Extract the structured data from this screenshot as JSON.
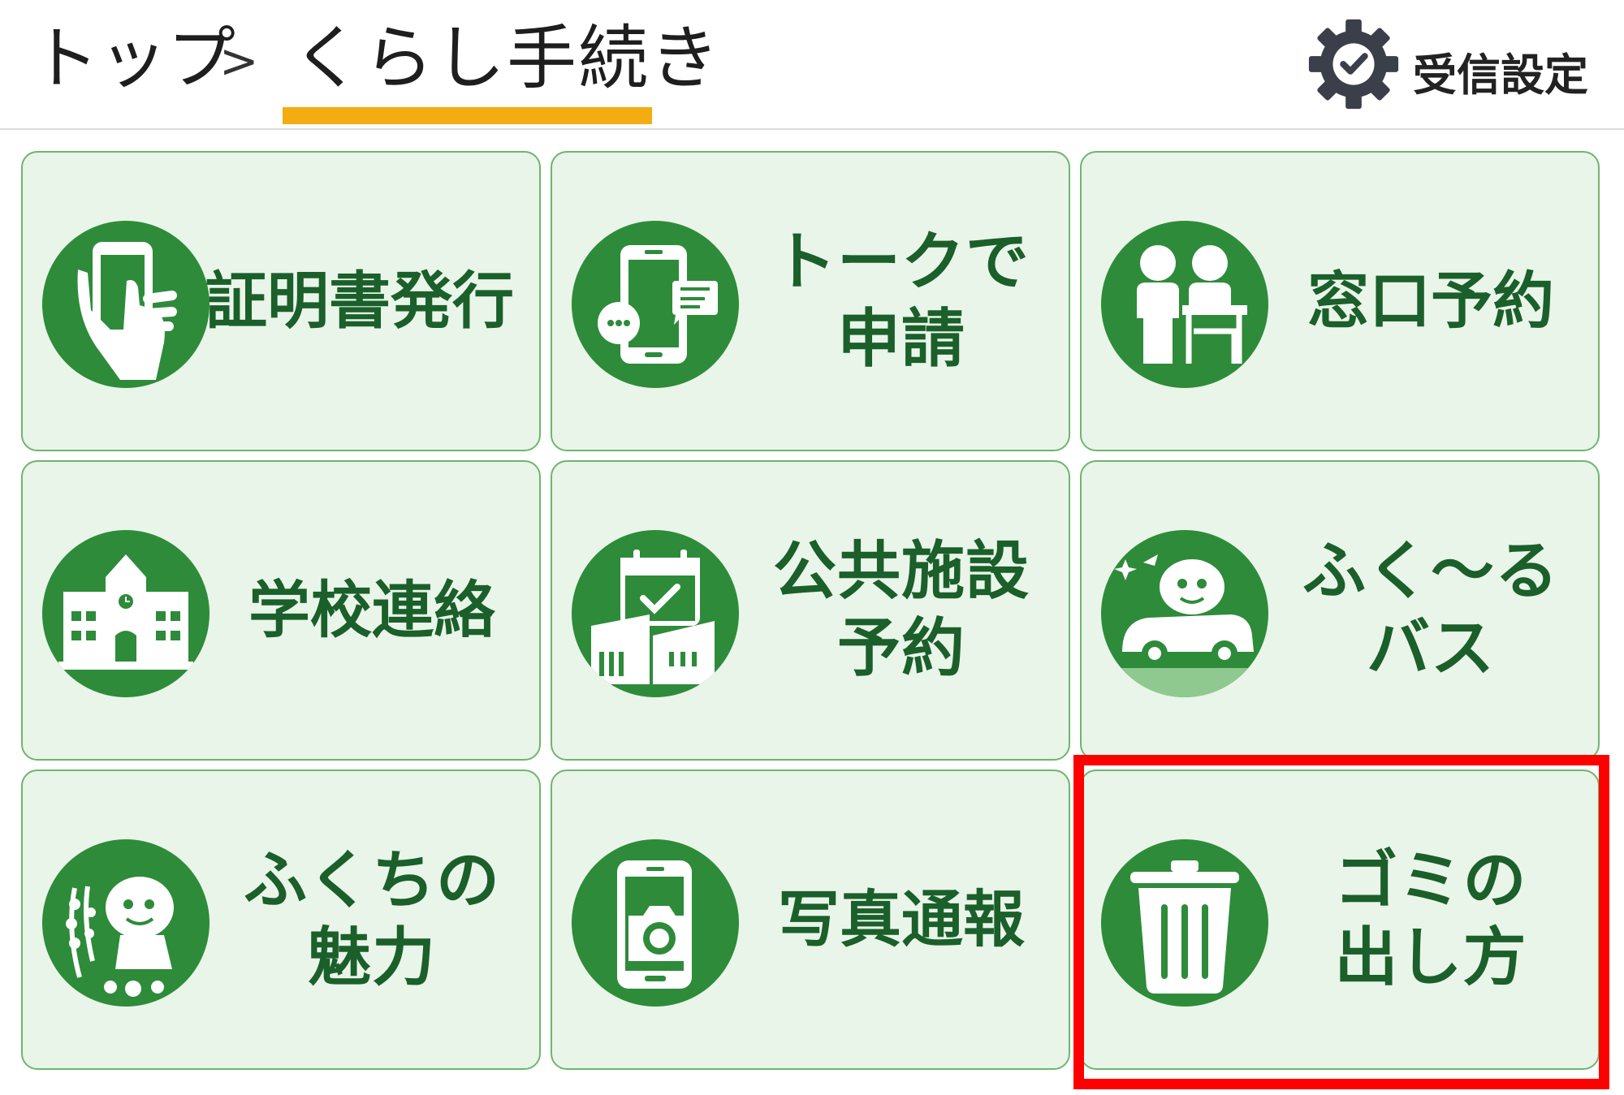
{
  "breadcrumb": {
    "top": "トップ",
    "separator": ">",
    "current": "くらし手続き"
  },
  "settings": {
    "label": "受信設定",
    "icon": "gear-check-icon"
  },
  "colors": {
    "accent_underline": "#f3ad12",
    "tile_background": "#e9f5e8",
    "tile_border": "#6fb570",
    "icon_circle": "#2e8b3a",
    "label_text": "#1b5f2b",
    "highlight": "#ff0000"
  },
  "tiles": [
    {
      "lines": [
        "証明書発行"
      ],
      "icon": "hand-phone-icon"
    },
    {
      "lines": [
        "トークで",
        "申請"
      ],
      "icon": "chat-phone-icon"
    },
    {
      "lines": [
        "窓口予約"
      ],
      "icon": "counter-people-icon"
    },
    {
      "lines": [
        "学校連絡"
      ],
      "icon": "school-building-icon"
    },
    {
      "lines": [
        "公共施設",
        "予約"
      ],
      "icon": "calendar-facility-icon"
    },
    {
      "lines": [
        "ふく～る",
        "バス"
      ],
      "icon": "mascot-bus-icon"
    },
    {
      "lines": [
        "ふくちの",
        "魅力"
      ],
      "icon": "mascot-flowers-icon"
    },
    {
      "lines": [
        "写真通報"
      ],
      "icon": "camera-phone-icon"
    },
    {
      "lines": [
        "ゴミの",
        "出し方"
      ],
      "icon": "trash-can-icon"
    }
  ]
}
